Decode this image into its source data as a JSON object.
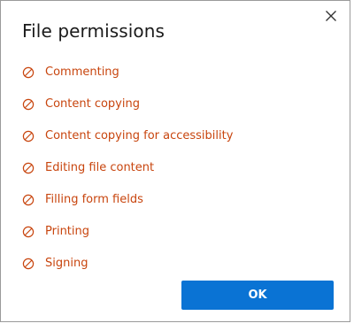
{
  "dialog": {
    "title": "File permissions",
    "close_icon": "close-icon",
    "permission_icon": "prohibited-icon",
    "accent_color": "#c8450e",
    "permissions": [
      {
        "label": "Commenting"
      },
      {
        "label": "Content copying"
      },
      {
        "label": "Content copying for accessibility"
      },
      {
        "label": "Editing file content"
      },
      {
        "label": "Filling form fields"
      },
      {
        "label": "Printing"
      },
      {
        "label": "Signing"
      }
    ],
    "ok_label": "OK",
    "ok_color": "#0a73d4"
  }
}
